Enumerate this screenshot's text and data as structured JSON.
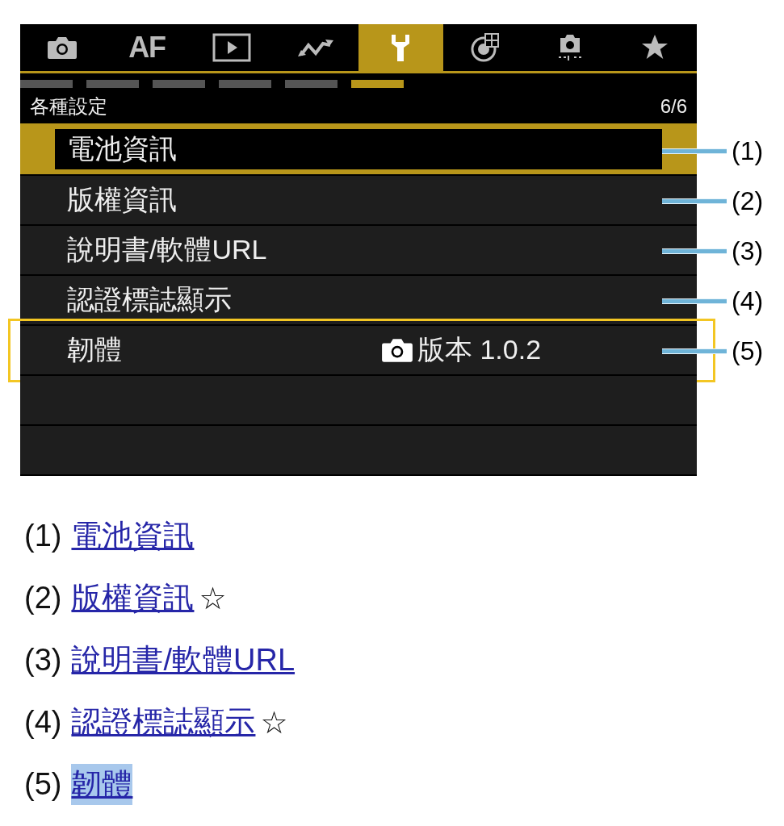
{
  "camera_screen": {
    "tabs": [
      {
        "kind": "camera",
        "selected": false
      },
      {
        "kind": "text",
        "label": "AF",
        "selected": false
      },
      {
        "kind": "play",
        "selected": false
      },
      {
        "kind": "wave",
        "selected": false
      },
      {
        "kind": "wrench",
        "selected": true
      },
      {
        "kind": "dial",
        "selected": false
      },
      {
        "kind": "camera-dots",
        "selected": false
      },
      {
        "kind": "star",
        "selected": false
      }
    ],
    "pages": [
      {
        "selected": false
      },
      {
        "selected": false
      },
      {
        "selected": false
      },
      {
        "selected": false
      },
      {
        "selected": false
      },
      {
        "selected": true
      }
    ],
    "header": {
      "title": "各種設定",
      "page": "6/6"
    },
    "items": [
      {
        "kind": "setting",
        "label": "電池資訊",
        "selected": true,
        "outlined": false,
        "callout": "(1)"
      },
      {
        "kind": "setting",
        "label": "版權資訊",
        "selected": false,
        "outlined": false,
        "callout": "(2)"
      },
      {
        "kind": "setting",
        "label": "說明書/軟體URL",
        "selected": false,
        "outlined": false,
        "callout": "(3)"
      },
      {
        "kind": "setting",
        "label": "認證標誌顯示",
        "selected": false,
        "outlined": false,
        "callout": "(4)"
      },
      {
        "kind": "setting",
        "label": "韌體",
        "value": "版本 1.0.2",
        "selected": false,
        "outlined": true,
        "callout": "(5)"
      },
      {
        "kind": "empty"
      },
      {
        "kind": "empty"
      }
    ]
  },
  "legend": [
    {
      "number": "(1)",
      "link": "電池資訊",
      "highlighted": false
    },
    {
      "number": "(2)",
      "link": "版權資訊",
      "mark": "☆",
      "highlighted": false
    },
    {
      "number": "(3)",
      "link": "說明書/軟體URL",
      "highlighted": false
    },
    {
      "number": "(4)",
      "link": "認證標誌顯示",
      "mark": "☆",
      "highlighted": false
    },
    {
      "number": "(5)",
      "link": "韌體",
      "highlighted": true
    }
  ]
}
